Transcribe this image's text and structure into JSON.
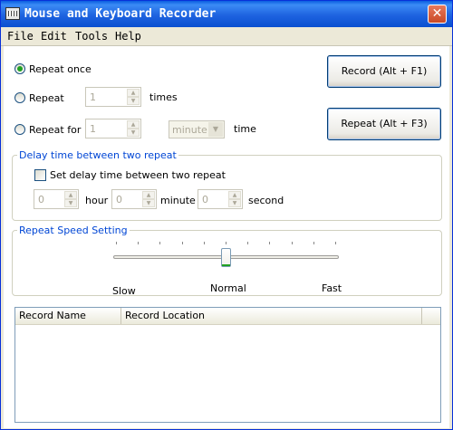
{
  "window": {
    "title": "Mouse and Keyboard Recorder",
    "close": "✕"
  },
  "menu": {
    "items": [
      "File",
      "Edit",
      "Tools",
      "Help"
    ]
  },
  "repeat": {
    "once_label": "Repeat once",
    "repeat_label": "Repeat",
    "repeat_value": "1",
    "times_label": "times",
    "repeat_for_label": "Repeat for",
    "repeat_for_value": "1",
    "unit_value": "minute",
    "time_label": "time",
    "selected": "once"
  },
  "buttons": {
    "record": "Record (Alt + F1)",
    "repeat": "Repeat (Alt + F3)"
  },
  "delay": {
    "group_title": "Delay time between two repeat",
    "checkbox_label": "Set delay time between two repeat",
    "checked": false,
    "hour_value": "0",
    "hour_label": "hour",
    "minute_value": "0",
    "minute_label": "minute",
    "second_value": "0",
    "second_label": "second"
  },
  "speed": {
    "group_title": "Repeat Speed Setting",
    "slow_label": "Slow",
    "normal_label": "Normal",
    "fast_label": "Fast",
    "level_fraction": 0.5
  },
  "records": {
    "columns": [
      "Record Name",
      "Record Location"
    ],
    "rows": []
  },
  "colors": {
    "accent": "#0046d5",
    "title_bar": "#0a5ee0",
    "radio_dot": "#21a121"
  }
}
